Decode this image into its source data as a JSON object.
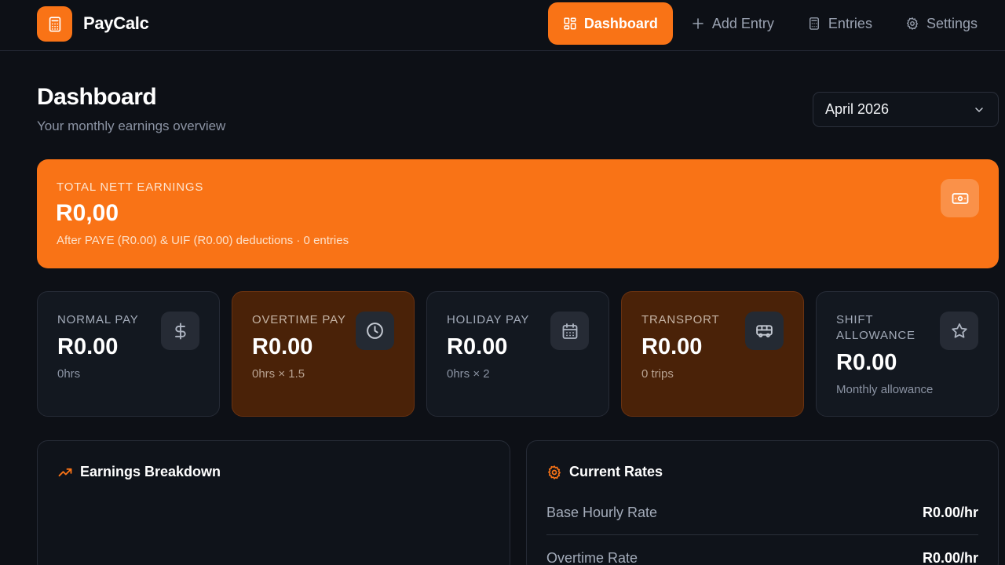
{
  "app": {
    "name": "PayCalc"
  },
  "nav": [
    {
      "label": "Dashboard",
      "icon": "dashboard-icon",
      "active": true
    },
    {
      "label": "Add Entry",
      "icon": "plus-icon",
      "active": false
    },
    {
      "label": "Entries",
      "icon": "calculator-icon",
      "active": false
    },
    {
      "label": "Settings",
      "icon": "gear-icon",
      "active": false
    }
  ],
  "header": {
    "title": "Dashboard",
    "subtitle": "Your monthly earnings overview",
    "month": "April 2026"
  },
  "hero": {
    "label": "TOTAL NETT EARNINGS",
    "amount": "R0,00",
    "note": "After PAYE (R0.00) & UIF (R0.00) deductions · 0 entries"
  },
  "stats": [
    {
      "label": "NORMAL PAY",
      "value": "R0.00",
      "sub": "0hrs",
      "icon": "dollar-icon"
    },
    {
      "label": "OVERTIME PAY",
      "value": "R0.00",
      "sub": "0hrs × 1.5",
      "icon": "clock-icon"
    },
    {
      "label": "HOLIDAY PAY",
      "value": "R0.00",
      "sub": "0hrs × 2",
      "icon": "calendar-icon"
    },
    {
      "label": "TRANSPORT",
      "value": "R0.00",
      "sub": "0 trips",
      "icon": "bus-icon"
    },
    {
      "label": "SHIFT ALLOWANCE",
      "value": "R0.00",
      "sub": "Monthly allowance",
      "icon": "star-icon"
    }
  ],
  "breakdown": {
    "title": "Earnings Breakdown"
  },
  "rates": {
    "title": "Current Rates",
    "rows": [
      {
        "name": "Base Hourly Rate",
        "value": "R0.00/hr"
      },
      {
        "name": "Overtime Rate",
        "value": "R0.00/hr"
      }
    ]
  },
  "colors": {
    "accent": "#f97316",
    "background": "#0d1016",
    "card": "#131820",
    "warm_card": "#4a2208"
  }
}
